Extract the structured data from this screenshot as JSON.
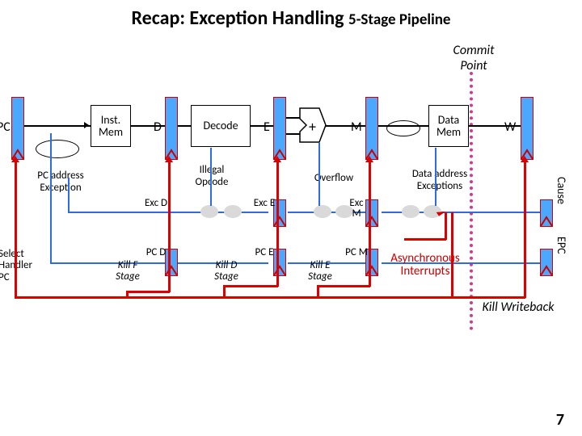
{
  "title": {
    "main": "Recap: Exception Handling",
    "sub": "5-Stage Pipeline"
  },
  "labels": {
    "commit_point": "Commit Point",
    "pc": "PC",
    "inst_mem": "Inst. Mem",
    "d": "D",
    "decode": "Decode",
    "e": "E",
    "plus": "+",
    "m": "M",
    "data_mem": "Data Mem",
    "w": "W",
    "pc_addr_exc": "PC address Exception",
    "illegal_opcode": "Illegal Opcode",
    "overflow": "Overflow",
    "data_addr_exc": "Data address Exceptions",
    "exc_d": "Exc D",
    "exc_e": "Exc E",
    "exc_m": "Exc M",
    "pc_d": "PC D",
    "pc_e": "PC E",
    "pc_m": "PC M",
    "select_handler": "Select Handler PC",
    "kill_f": "Kill F Stage",
    "kill_d": "Kill D Stage",
    "kill_e": "Kill E Stage",
    "async_int": "Asynchronous Interrupts",
    "kill_wb": "Kill Writeback",
    "cause": "Cause",
    "epc": "EPC"
  },
  "page_number": "7"
}
